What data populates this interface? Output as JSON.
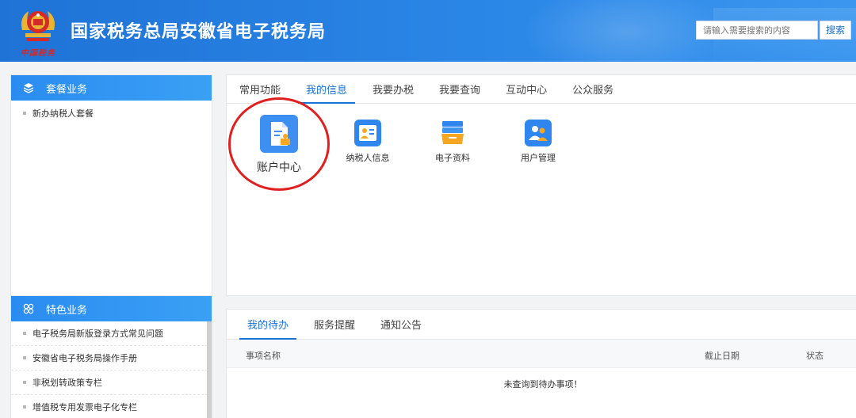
{
  "header": {
    "emblem_text": "中国税务",
    "title": "国家税务总局安徽省电子税务局",
    "search_placeholder": "请输入需要搜索的内容",
    "search_button": "搜索"
  },
  "sidebar": {
    "packages": {
      "title": "套餐业务",
      "items": [
        {
          "label": "新办纳税人套餐"
        }
      ]
    },
    "featured": {
      "title": "特色业务",
      "items": [
        {
          "label": "电子税务局新版登录方式常见问题"
        },
        {
          "label": "安徽省电子税务局操作手册"
        },
        {
          "label": "非税划转政策专栏"
        },
        {
          "label": "增值税专用发票电子化专栏"
        }
      ]
    }
  },
  "main_tabs": [
    {
      "label": "常用功能",
      "active": false
    },
    {
      "label": "我的信息",
      "active": true
    },
    {
      "label": "我要办税",
      "active": false
    },
    {
      "label": "我要查询",
      "active": false
    },
    {
      "label": "互动中心",
      "active": false
    },
    {
      "label": "公众服务",
      "active": false
    }
  ],
  "apps": [
    {
      "label": "账户中心",
      "icon": "account-document-icon",
      "color": "#3d8ff2"
    },
    {
      "label": "纳税人信息",
      "icon": "id-card-icon",
      "color": "#2f86ee"
    },
    {
      "label": "电子资料",
      "icon": "folder-stack-icon",
      "color": "#2f86ee"
    },
    {
      "label": "用户管理",
      "icon": "users-icon",
      "color": "#2f86ee"
    }
  ],
  "todo": {
    "tabs": [
      {
        "label": "我的待办",
        "active": true
      },
      {
        "label": "服务提醒",
        "active": false
      },
      {
        "label": "通知公告",
        "active": false
      }
    ],
    "columns": {
      "name": "事项名称",
      "deadline": "截止日期",
      "status": "状态"
    },
    "empty_message": "未查询到待办事项！"
  },
  "colors": {
    "header": "#1f73d6",
    "accent": "#1a72d8",
    "annotation": "#e02020",
    "orange": "#f5a623"
  }
}
